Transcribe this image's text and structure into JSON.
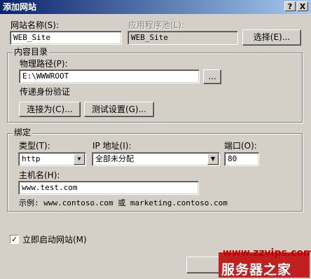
{
  "window": {
    "title": "添加网站",
    "help": "?",
    "close": "X"
  },
  "site": {
    "name_label": "网站名称(S):",
    "name_value": "WEB_Site",
    "pool_label": "应用程序池(L):",
    "pool_value": "WEB_Site",
    "select_button": "选择(E)..."
  },
  "content": {
    "legend": "内容目录",
    "path_label": "物理路径(P):",
    "path_value": "E:\\WWWROOT",
    "browse_button": "...",
    "auth_label": "传递身份验证",
    "connect_button": "连接为(C)...",
    "test_button": "测试设置(G)..."
  },
  "binding": {
    "legend": "绑定",
    "type_label": "类型(T):",
    "type_value": "http",
    "ip_label": "IP 地址(I):",
    "ip_value": "全部未分配",
    "port_label": "端口(O):",
    "port_value": "80",
    "host_label": "主机名(H):",
    "host_value": "www.test.com",
    "example": "示例: www.contoso.com 或 marketing.contoso.com"
  },
  "start": {
    "label": "立即启动网站(M)",
    "checked": true
  },
  "watermark": {
    "url": "www.zzvips.com",
    "name": "服务器之家"
  },
  "colors": {
    "titlebar": "#0a246a",
    "face": "#d4d0c8",
    "watermark": "#c02020"
  }
}
